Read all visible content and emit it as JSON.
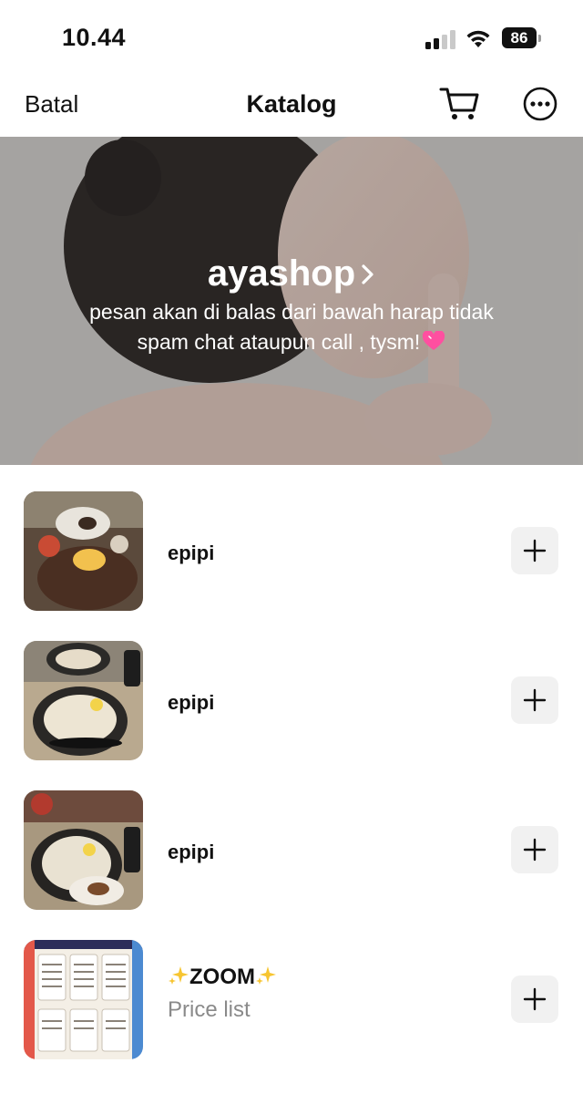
{
  "status_bar": {
    "time": "10.44",
    "battery_level": "86"
  },
  "nav": {
    "cancel_label": "Batal",
    "title": "Katalog",
    "cart_icon": "cart-icon",
    "more_icon": "more-options-icon"
  },
  "shop": {
    "name": "ayashop",
    "description": "pesan akan di balas dari bawah harap tidak spam chat ataupun call , tysm!"
  },
  "products": [
    {
      "name": "epipi",
      "subtitle": ""
    },
    {
      "name": "epipi",
      "subtitle": ""
    },
    {
      "name": "epipi",
      "subtitle": ""
    },
    {
      "name": "ZOOM",
      "subtitle": "Price list"
    }
  ],
  "colors": {
    "add_button_bg": "#f1f1f1",
    "subtitle_gray": "#8a8a8a",
    "heart_pink": "#ff4fa0",
    "sparkle_gold": "#f7c531"
  }
}
